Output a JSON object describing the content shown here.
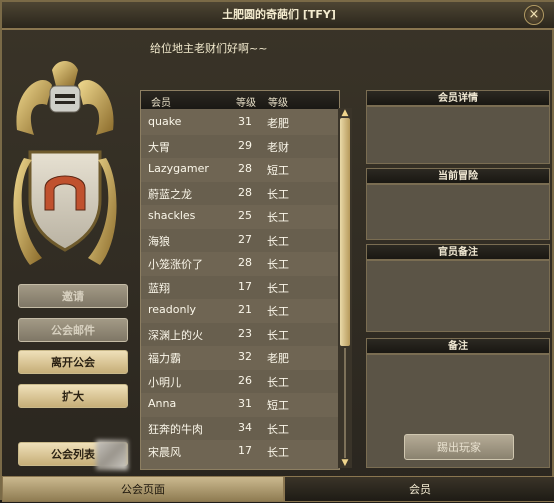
{
  "window": {
    "title": "土肥圆的奇葩们 [TFY]",
    "close_glyph": "×"
  },
  "greeting": "给位地主老财们好啊~~",
  "sidebar": {
    "buttons": [
      {
        "label": "邀请",
        "enabled": false
      },
      {
        "label": "公会邮件",
        "enabled": false
      },
      {
        "label": "离开公会",
        "enabled": true
      },
      {
        "label": "扩大",
        "enabled": true
      },
      {
        "label": "公会列表",
        "enabled": true
      }
    ]
  },
  "members": {
    "headers": {
      "name": "会员",
      "level": "等级",
      "rank": "等级"
    },
    "rows": [
      {
        "name": "quake",
        "level": "31",
        "rank": "老肥"
      },
      {
        "name": "大胃",
        "level": "29",
        "rank": "老财"
      },
      {
        "name": "Lazygamer",
        "level": "28",
        "rank": "短工"
      },
      {
        "name": "蔚蓝之龙",
        "level": "28",
        "rank": "长工"
      },
      {
        "name": "shackles",
        "level": "25",
        "rank": "长工"
      },
      {
        "name": "海狼",
        "level": "27",
        "rank": "长工"
      },
      {
        "name": "小笼涨价了",
        "level": "28",
        "rank": "长工"
      },
      {
        "name": "蓝翔",
        "level": "17",
        "rank": "长工"
      },
      {
        "name": "readonly",
        "level": "21",
        "rank": "长工"
      },
      {
        "name": "深渊上的火",
        "level": "23",
        "rank": "长工"
      },
      {
        "name": "福力霸",
        "level": "32",
        "rank": "老肥"
      },
      {
        "name": "小明儿",
        "level": "26",
        "rank": "长工"
      },
      {
        "name": "Anna",
        "level": "31",
        "rank": "短工"
      },
      {
        "name": "狂奔的牛肉",
        "level": "34",
        "rank": "长工"
      },
      {
        "name": "宋晨风",
        "level": "17",
        "rank": "长工"
      }
    ]
  },
  "right_panel": {
    "member_details": "会员详情",
    "current_adventure": "当前冒险",
    "officer_note": "官员备注",
    "note": "备注",
    "kick_button": "踢出玩家"
  },
  "tabs": {
    "guild_page": "公会页面",
    "members": "会员"
  },
  "colors": {
    "accent_gold": "#c8b27a",
    "list_bg": "#6f6553"
  }
}
